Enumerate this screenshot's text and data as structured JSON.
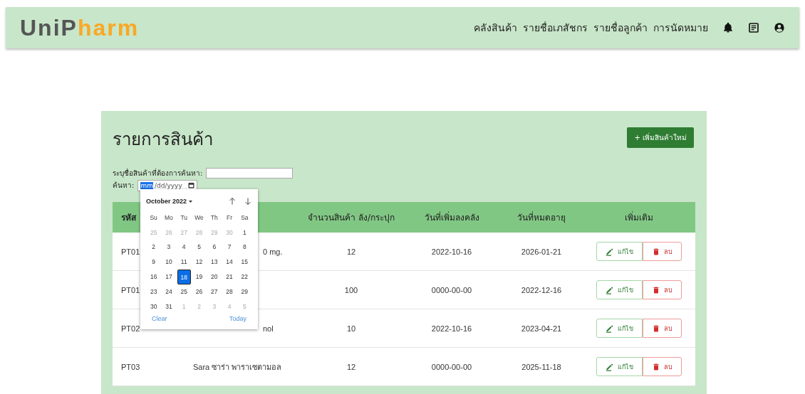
{
  "navbar": {
    "logo": [
      {
        "text": "Uni",
        "kind": "dark"
      },
      {
        "text": "P",
        "kind": "dark"
      },
      {
        "text": "harm",
        "kind": "orange"
      }
    ],
    "links": [
      "คลังสินค้า",
      "รายชื่อเภสัชกร",
      "รายชื่อลูกค้า",
      "การนัดหมาย"
    ]
  },
  "page": {
    "title": "รายการสินค้า",
    "add_button": "+ เพิ่มสินค้าใหม่",
    "search_label": "ระบุชื่อสินค้าที่ต้องการค้นหา:",
    "date_label": "ค้นหา:",
    "date_parts": [
      "mm",
      "/dd/yyyy"
    ]
  },
  "table": {
    "columns": [
      "รหัส",
      "จำนวนสินค้า ลัง/กระปุก",
      "วันที่เพิ่มลงคลัง",
      "วันที่หมดอายุ",
      "เพิ่มเติม"
    ],
    "rows": [
      {
        "code": "PT01",
        "name": "0 mg.",
        "name_covered": true,
        "qty": "12",
        "added": "2022-10-16",
        "expiry": "2026-01-21",
        "edit": "แก้ไข",
        "delete": "ลบ"
      },
      {
        "code": "PT01",
        "qty": "100",
        "added": "0000-00-00",
        "expiry": "2022-12-16",
        "edit": "แก้ไข",
        "delete": "ลบ"
      },
      {
        "code": "PT02",
        "name": "nol",
        "name_covered": true,
        "qty": "10",
        "added": "2022-10-16",
        "expiry": "2023-04-21",
        "edit": "แก้ไข",
        "delete": "ลบ"
      },
      {
        "code": "PT03",
        "name": "Sara ซาร่า พาราเซตามอล",
        "name_covered": false,
        "qty": "12",
        "added": "0000-00-00",
        "expiry": "2025-11-18",
        "edit": "แก้ไข",
        "delete": "ลบ"
      }
    ]
  },
  "datepicker": {
    "month": "October 2022",
    "weekdays": [
      "Su",
      "Mo",
      "Tu",
      "We",
      "Th",
      "Fr",
      "Sa"
    ],
    "days": [
      {
        "d": "25",
        "other": true,
        "selected": false
      },
      {
        "d": "26",
        "other": true,
        "selected": false
      },
      {
        "d": "27",
        "other": true,
        "selected": false
      },
      {
        "d": "28",
        "other": true,
        "selected": false
      },
      {
        "d": "29",
        "other": true,
        "selected": false
      },
      {
        "d": "30",
        "other": true,
        "selected": false
      },
      {
        "d": "1",
        "other": false,
        "selected": false
      },
      {
        "d": "2",
        "other": false,
        "selected": false
      },
      {
        "d": "3",
        "other": false,
        "selected": false
      },
      {
        "d": "4",
        "other": false,
        "selected": false
      },
      {
        "d": "5",
        "other": false,
        "selected": false
      },
      {
        "d": "6",
        "other": false,
        "selected": false
      },
      {
        "d": "7",
        "other": false,
        "selected": false
      },
      {
        "d": "8",
        "other": false,
        "selected": false
      },
      {
        "d": "9",
        "other": false,
        "selected": false
      },
      {
        "d": "10",
        "other": false,
        "selected": false
      },
      {
        "d": "11",
        "other": false,
        "selected": false
      },
      {
        "d": "12",
        "other": false,
        "selected": false
      },
      {
        "d": "13",
        "other": false,
        "selected": false
      },
      {
        "d": "14",
        "other": false,
        "selected": false
      },
      {
        "d": "15",
        "other": false,
        "selected": false
      },
      {
        "d": "16",
        "other": false,
        "selected": false
      },
      {
        "d": "17",
        "other": false,
        "selected": false
      },
      {
        "d": "18",
        "other": false,
        "selected": true
      },
      {
        "d": "19",
        "other": false,
        "selected": false
      },
      {
        "d": "20",
        "other": false,
        "selected": false
      },
      {
        "d": "21",
        "other": false,
        "selected": false
      },
      {
        "d": "22",
        "other": false,
        "selected": false
      },
      {
        "d": "23",
        "other": false,
        "selected": false
      },
      {
        "d": "24",
        "other": false,
        "selected": false
      },
      {
        "d": "25",
        "other": false,
        "selected": false
      },
      {
        "d": "26",
        "other": false,
        "selected": false
      },
      {
        "d": "27",
        "other": false,
        "selected": false
      },
      {
        "d": "28",
        "other": false,
        "selected": false
      },
      {
        "d": "29",
        "other": false,
        "selected": false
      },
      {
        "d": "30",
        "other": false,
        "selected": false
      },
      {
        "d": "31",
        "other": false,
        "selected": false
      },
      {
        "d": "1",
        "other": true,
        "selected": false
      },
      {
        "d": "2",
        "other": true,
        "selected": false
      },
      {
        "d": "3",
        "other": true,
        "selected": false
      },
      {
        "d": "4",
        "other": true,
        "selected": false
      },
      {
        "d": "5",
        "other": true,
        "selected": false
      }
    ],
    "clear": "Clear",
    "today": "Today"
  }
}
